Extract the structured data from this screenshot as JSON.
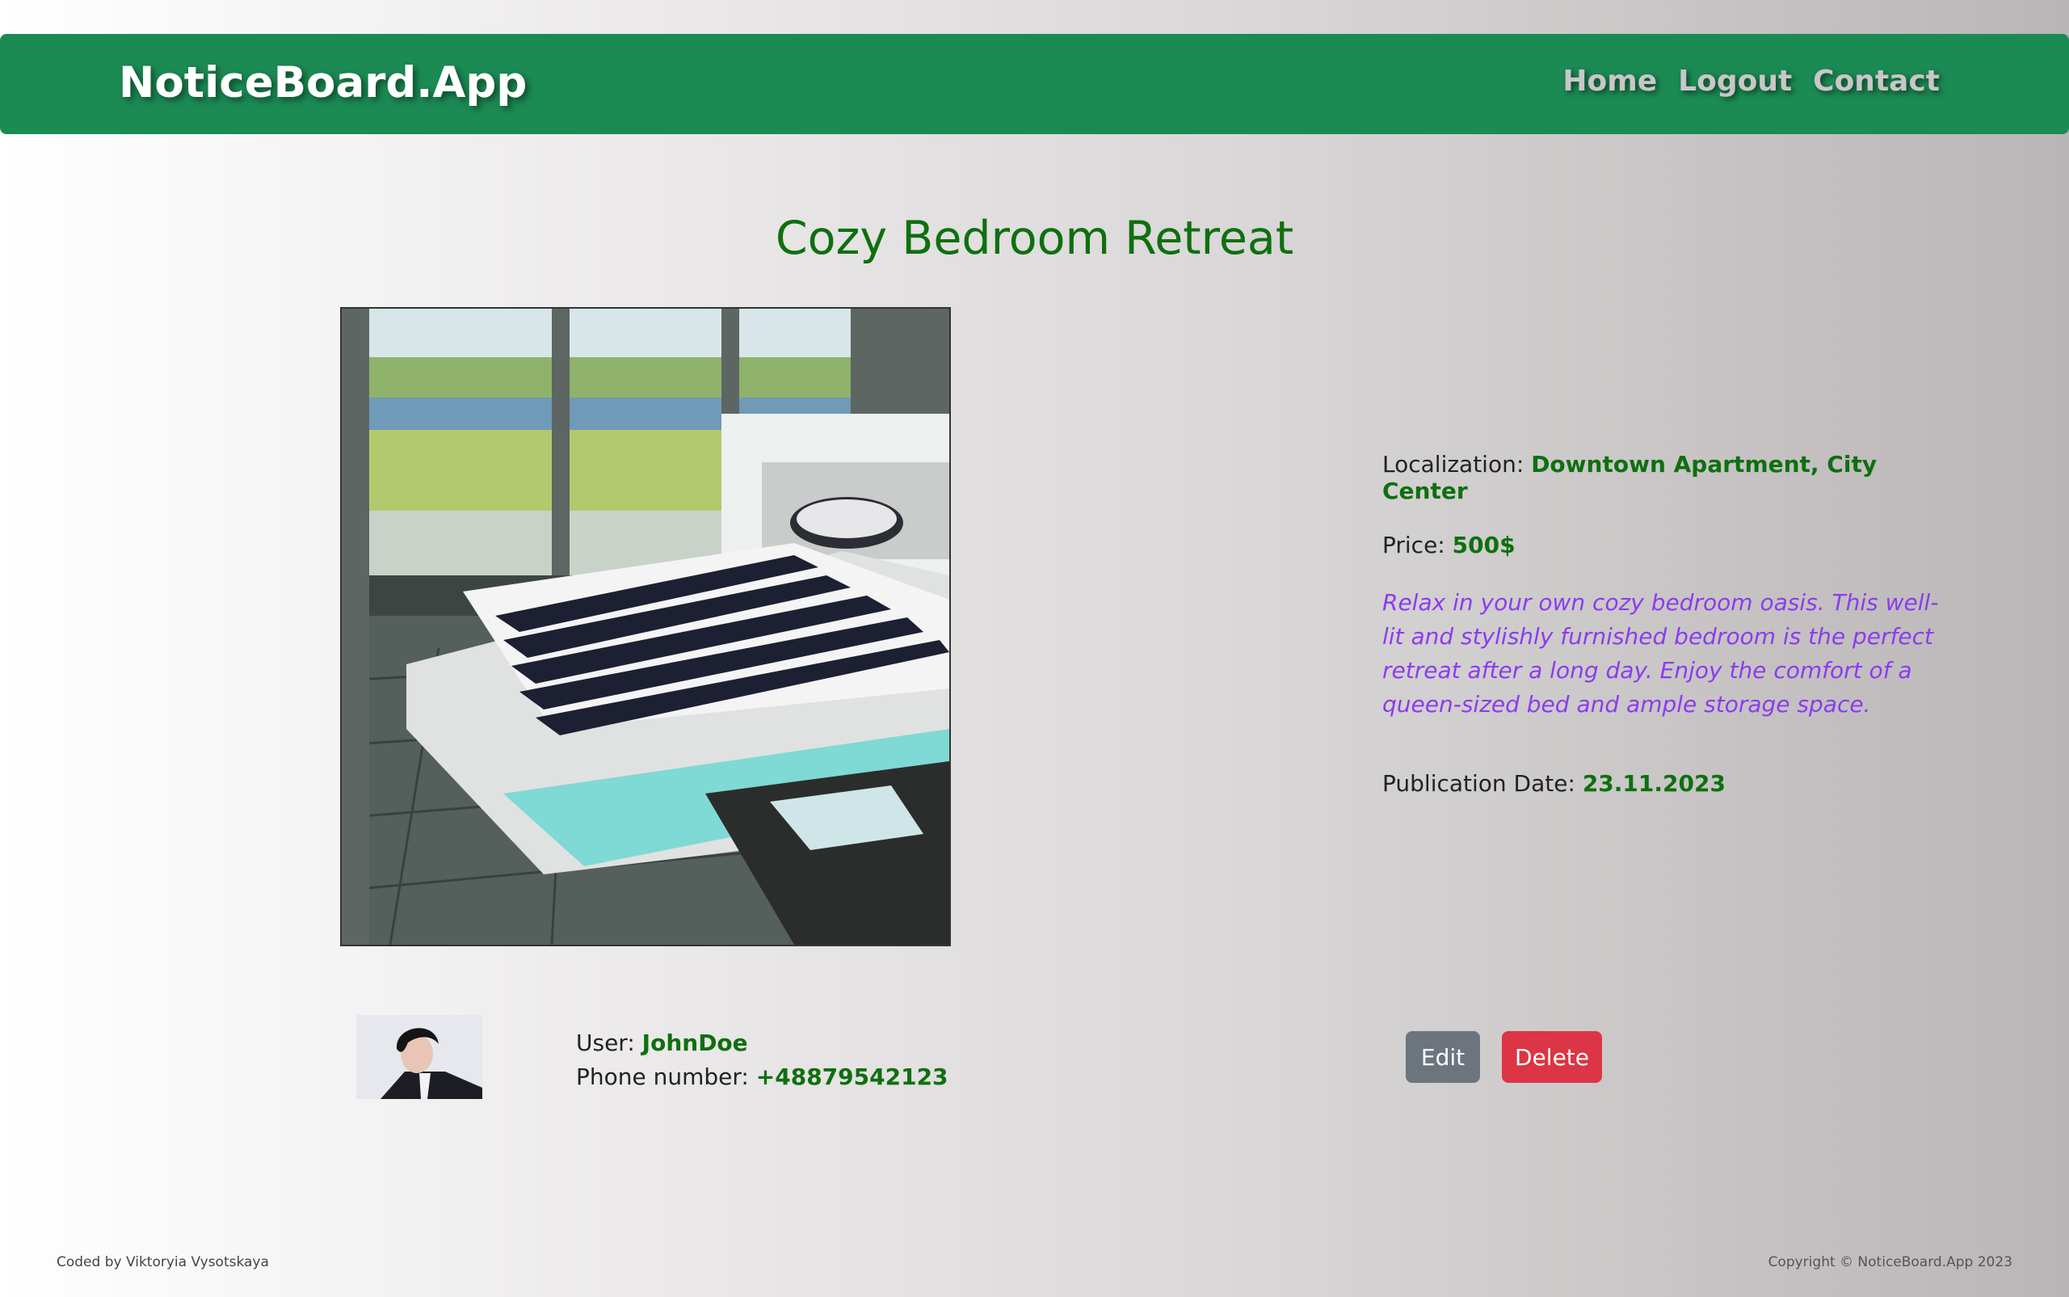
{
  "navbar": {
    "brand": "NoticeBoard.App",
    "links": [
      "Home",
      "Logout",
      "Contact"
    ],
    "color": "#1b8a53"
  },
  "notice": {
    "title": "Cozy Bedroom Retreat",
    "localization_label": "Localization:",
    "localization": "Downtown Apartment, City Center",
    "price_label": "Price:",
    "price": "500$",
    "description": "Relax in your own cozy bedroom oasis. This well-lit and stylishly furnished bedroom is the perfect retreat after a long day. Enjoy the comfort of a queen-sized bed and ample storage space.",
    "date_label": "Publication Date:",
    "date": "23.11.2023"
  },
  "owner": {
    "user_label": "User:",
    "user": "JohnDoe",
    "phone_label": "Phone number:",
    "phone": "+48879542123"
  },
  "actions": {
    "edit": "Edit",
    "delete": "Delete"
  },
  "footer": {
    "left": "Coded by Viktoryia Vysotskaya",
    "right": "Copyright © NoticeBoard.App 2023"
  }
}
